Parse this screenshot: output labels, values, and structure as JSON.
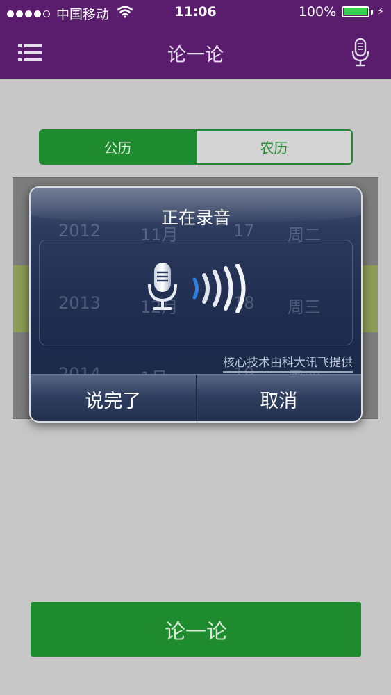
{
  "status_bar": {
    "carrier": "中国移动",
    "time": "11:06",
    "battery_percent": "100%",
    "signal_dots_filled": 4,
    "signal_dots_total": 5,
    "battery_color": "#35d24a"
  },
  "navbar": {
    "title": "论一论",
    "background": "#5a1d6e",
    "left_icon": "menu-list-icon",
    "right_icon": "microphone-icon"
  },
  "segmented": {
    "options": [
      "公历",
      "农历"
    ],
    "selected": "公历",
    "accent": "#1e8b2e"
  },
  "picker": {
    "rows": [
      {
        "year": "2012",
        "month": "11月",
        "day": "17",
        "weekday": "周二"
      },
      {
        "year": "2013",
        "month": "12月",
        "day": "18",
        "weekday": "周三"
      },
      {
        "year": "2014",
        "month": "1月",
        "day": "19",
        "weekday": "周四"
      }
    ]
  },
  "dialog": {
    "title": "正在录音",
    "credit": "核心技术由科大讯飞提供",
    "done_button": "说完了",
    "cancel_button": "取消",
    "mic_icon": "microphone-icon",
    "volume_icon": "sound-waves-icon"
  },
  "bottom_button": {
    "label": "论一论"
  }
}
